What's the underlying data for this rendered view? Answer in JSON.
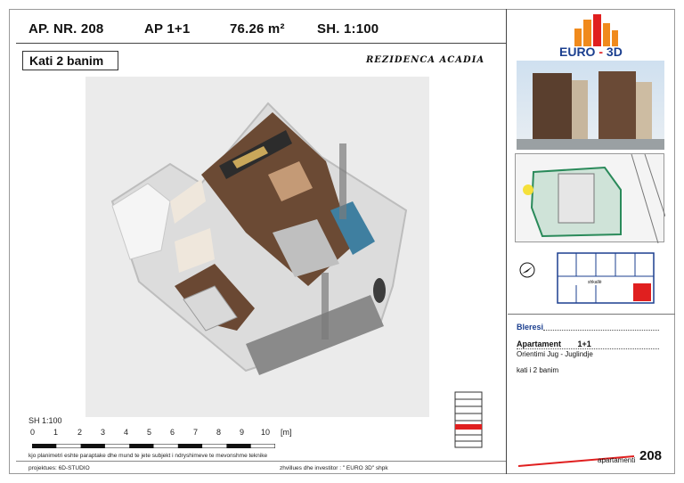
{
  "header": {
    "apartment_no": "AP. NR. 208",
    "type": "AP 1+1",
    "area": "76.26 m²",
    "scale": "SH. 1:100"
  },
  "floor_label": "Kati 2 banim",
  "residence_name": "REZIDENCA ACADIA",
  "scale_bar": {
    "label": "SH 1:100",
    "ticks": [
      "0",
      "1",
      "2",
      "3",
      "4",
      "5",
      "6",
      "7",
      "8",
      "9",
      "10"
    ],
    "unit": "[m]"
  },
  "disclaimer": "kjo planimetri eshte paraptake dhe mund te jete subjekt i ndryshimeve te mevonshme teknike",
  "footer": {
    "project": "projektues:   6D-STUDIO",
    "developer": "zhvillues dhe investitor :  \" EURO 3D\" shpk",
    "apartment_label": "apartamenti",
    "apartment_number": "208"
  },
  "logo": {
    "text_left": "EURO",
    "text_right": "3D",
    "separator": "-"
  },
  "site_plan": {
    "label": "shkallë"
  },
  "info_panel": {
    "buyer_label": "Bleresi",
    "apartment_label": "Apartament",
    "apartment_type": "1+1",
    "orientation": "Orientimi  Jug - Juglindje",
    "floor": "kati i 2 banim"
  },
  "colors": {
    "accent_red": "#e01f1f",
    "orange": "#f08a1c",
    "blue_text": "#1b3f8f",
    "sofa": "#3f7fa0"
  }
}
